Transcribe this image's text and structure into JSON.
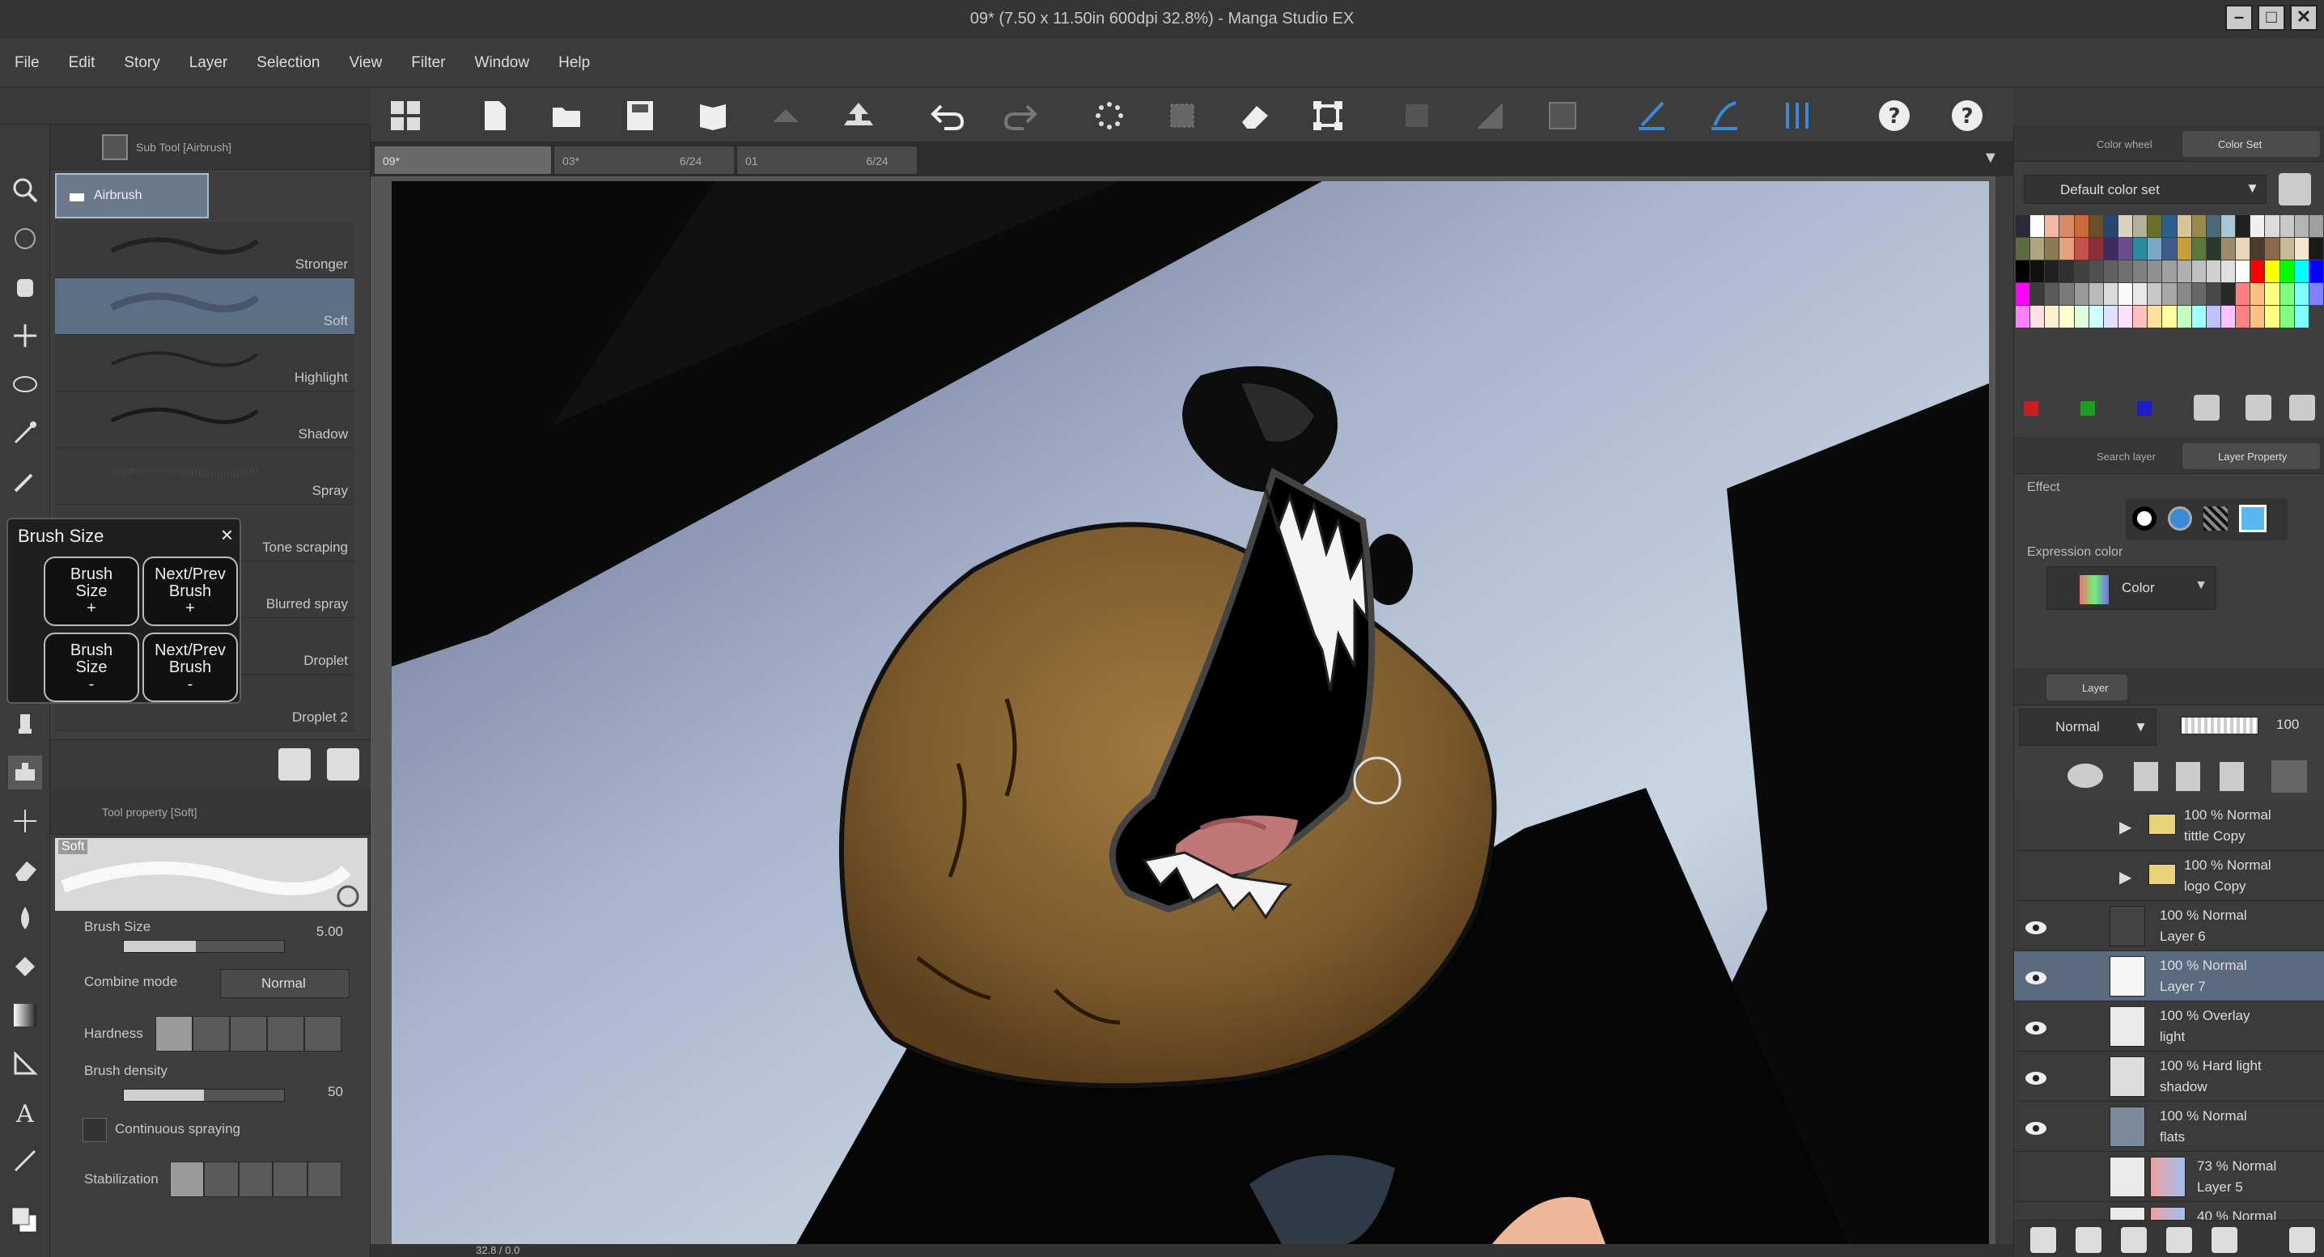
{
  "window": {
    "title": "09* (7.50 x 11.50in 600dpi 32.8%)  - Manga Studio EX"
  },
  "menu": [
    "File",
    "Edit",
    "Story",
    "Layer",
    "Selection",
    "View",
    "Filter",
    "Window",
    "Help"
  ],
  "subtool": {
    "tab_label": "Sub Tool [Airbrush]",
    "group": "Airbrush",
    "brushes": [
      "Stronger",
      "Soft",
      "Highlight",
      "Shadow",
      "Spray",
      "Tone scraping",
      "Blurred spray",
      "Droplet",
      "Droplet 2"
    ],
    "selected_brush": "Soft"
  },
  "brush_size_popup": {
    "title": "Brush Size",
    "close": "×",
    "buttons": [
      {
        "line1": "Brush",
        "line2": "Size",
        "sign": "+"
      },
      {
        "line1": "Next/Prev",
        "line2": "Brush",
        "sign": "+"
      },
      {
        "line1": "Brush",
        "line2": "Size",
        "sign": "-"
      },
      {
        "line1": "Next/Prev",
        "line2": "Brush",
        "sign": "-"
      }
    ]
  },
  "tool_property": {
    "tab_label": "Tool property [Soft]",
    "preview_label": "Soft",
    "brush_size_label": "Brush Size",
    "brush_size_value": "5.00",
    "combine_mode_label": "Combine mode",
    "combine_mode_value": "Normal",
    "hardness_label": "Hardness",
    "brush_density_label": "Brush density",
    "brush_density_value": "50",
    "continuous_label": "Continuous spraying",
    "stabilization_label": "Stabilization"
  },
  "doc_tabs": [
    {
      "label": "09*",
      "active": true
    },
    {
      "label": "03*",
      "pages": "6/24"
    },
    {
      "label": "01",
      "pages": "6/24"
    }
  ],
  "status": {
    "zoom": "32.8 / 0.0"
  },
  "color_panel": {
    "tabs": [
      "Color wheel",
      "Color Set"
    ],
    "set_name": "Default color set",
    "swatches": [
      "#2a2a3a",
      "#ffffff",
      "#f4b7a5",
      "#d68d67",
      "#c86a3c",
      "#6a4e2c",
      "#27456e",
      "#d8d4c0",
      "#b2b29a",
      "#6b6f2a",
      "#2c5f8f",
      "#d8c49a",
      "#9a8a4a",
      "#4a6a7a",
      "#a8c8d8",
      "#202020",
      "#f0f0f0",
      "#dcdcdc",
      "#c8c8c8",
      "#b4b4b4",
      "#a0a0a0",
      "#5c6a3e",
      "#b4a47c",
      "#8c7a52",
      "#e6a07c",
      "#c2524a",
      "#8a2e3a",
      "#3e2a5c",
      "#6a4e8c",
      "#2c8a9a",
      "#7aa8c4",
      "#3c5a8a",
      "#c7a03a",
      "#5a7a3a",
      "#2a3a2a",
      "#9c8c6c",
      "#e8d8b8",
      "#4a3a2a",
      "#8a6a4a",
      "#c8b89a",
      "#f2e8d0",
      "#1a1a1a",
      "#000000",
      "#101010",
      "#202020",
      "#303030",
      "#404040",
      "#505050",
      "#606060",
      "#707070",
      "#808080",
      "#909090",
      "#a0a0a0",
      "#b0b0b0",
      "#c0c0c0",
      "#d0d0d0",
      "#e0e0e0",
      "#ffffff",
      "#ff0000",
      "#ffff00",
      "#00ff00",
      "#00ffff",
      "#0000ff",
      "#ff00ff",
      "#3a3a3a",
      "#5a5a5a",
      "#7a7a7a",
      "#9a9a9a",
      "#bababa",
      "#dadada",
      "#fafafa",
      "#e8e8e8",
      "#c8c8c8",
      "#a8a8a8",
      "#888888",
      "#686868",
      "#484848",
      "#282828",
      "#ff7f7f",
      "#ffbf7f",
      "#ffff7f",
      "#7fff7f",
      "#7fffff",
      "#7f7fff",
      "#ff7fff",
      "#ffe0e0",
      "#fff0d0",
      "#ffffd0",
      "#e0ffe0",
      "#d0ffff",
      "#e0e0ff",
      "#ffe0ff",
      "#ffc0c0",
      "#ffe0a0",
      "#ffffa0",
      "#c0ffc0",
      "#a0ffff",
      "#c0c0ff",
      "#ffc0ff",
      "#ff8080",
      "#ffc080",
      "#ffff80",
      "#80ff80",
      "#80ffff"
    ]
  },
  "layer_property": {
    "tabs": [
      "Search layer",
      "Layer Property"
    ],
    "effect_label": "Effect",
    "expression_label": "Expression color",
    "expression_value": "Color"
  },
  "layer_panel": {
    "tab_label": "Layer",
    "blend_mode": "Normal",
    "opacity": "100",
    "layers": [
      {
        "line1": "100 %  Normal",
        "line2": "tittle Copy",
        "type": "folder"
      },
      {
        "line1": "100 %  Normal",
        "line2": "logo Copy",
        "type": "folder"
      },
      {
        "line1": "100 %  Normal",
        "line2": "Layer 6",
        "type": "layer"
      },
      {
        "line1": "100 %  Normal",
        "line2": "Layer 7",
        "type": "layer",
        "selected": true
      },
      {
        "line1": "100 %  Overlay",
        "line2": "light",
        "type": "layer"
      },
      {
        "line1": "100 %  Hard light",
        "line2": "shadow",
        "type": "layer"
      },
      {
        "line1": "100 %  Normal",
        "line2": "flats",
        "type": "layer"
      },
      {
        "line1": "73 %  Normal",
        "line2": "Layer 5",
        "type": "mask"
      },
      {
        "line1": "40 %  Normal",
        "line2": "",
        "type": "mask"
      }
    ]
  }
}
